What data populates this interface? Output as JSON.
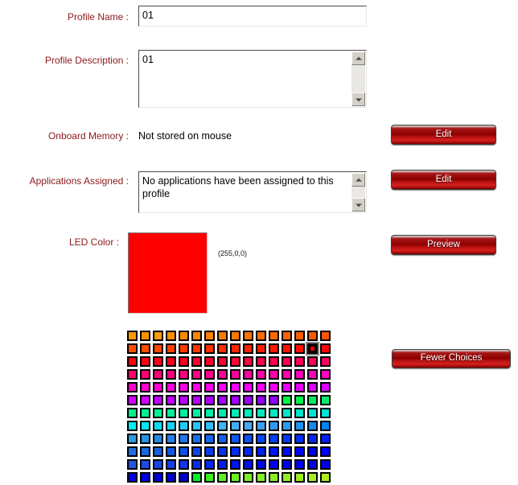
{
  "form": {
    "profile_name": {
      "label": "Profile Name :",
      "value": "01"
    },
    "profile_description": {
      "label": "Profile Description :",
      "value": "01"
    },
    "onboard_memory": {
      "label": "Onboard Memory :",
      "value": "Not stored on mouse",
      "button": "Edit"
    },
    "applications_assigned": {
      "label": "Applications Assigned :",
      "value": "No applications have been assigned to this profile",
      "button": "Edit"
    },
    "led_color": {
      "label": "LED Color :",
      "swatch_hex": "#FF0000",
      "rgb_text": "(255,0,0)",
      "button": "Preview"
    },
    "palette": {
      "fewer_choices_button": "Fewer Choices",
      "columns": 16,
      "rows": 12,
      "selected_index": 30,
      "colors": [
        "#FF9900",
        "#FF8F00",
        "#FF9A0A",
        "#FF8C00",
        "#FF8A00",
        "#FF8500",
        "#FF8000",
        "#FF7B00",
        "#FF7600",
        "#FF7200",
        "#FF6D00",
        "#FF6800",
        "#FF6300",
        "#FF5E00",
        "#FF5900",
        "#FF5400",
        "#FF4F00",
        "#FF4A00",
        "#FF4500",
        "#FF4000",
        "#FF3B00",
        "#FF3600",
        "#FF3100",
        "#FF2C00",
        "#FF2700",
        "#FF2200",
        "#FF1D00",
        "#FF1800",
        "#FF1300",
        "#FF0E00",
        "#FF0000",
        "#FF0505",
        "#FF000A",
        "#FF0010",
        "#FF0016",
        "#FF001C",
        "#FF0022",
        "#FF0028",
        "#FF002E",
        "#FF0034",
        "#FF003A",
        "#FF0040",
        "#FF0046",
        "#FF004C",
        "#FF0052",
        "#FF0058",
        "#FF005E",
        "#FF0064",
        "#FF006A",
        "#FF0070",
        "#FF0076",
        "#FF007C",
        "#FF0082",
        "#FF0088",
        "#FF008E",
        "#FF0094",
        "#FF009A",
        "#FF00A0",
        "#FF00A6",
        "#FF00AC",
        "#FF00B2",
        "#FF00B8",
        "#FF00BE",
        "#FF00C4",
        "#FF00CA",
        "#FF00D0",
        "#FF00D6",
        "#FF00DC",
        "#FF00E2",
        "#FF00E8",
        "#FF00EE",
        "#FF00F4",
        "#FF00FA",
        "#FD00FF",
        "#F700FF",
        "#F100FF",
        "#EB00FF",
        "#E500FF",
        "#DF00FF",
        "#D900FF",
        "#D300FF",
        "#CD00FF",
        "#C700FF",
        "#C100FF",
        "#BB00FF",
        "#B500FF",
        "#AF00FF",
        "#A900FF",
        "#A300FF",
        "#9D00FF",
        "#9700FF",
        "#9100FF",
        "#00F542",
        "#00F24F",
        "#00EF5C",
        "#00EC69",
        "#00F08C",
        "#00F091",
        "#00F096",
        "#00EF9B",
        "#00EEA0",
        "#00EDA5",
        "#00ECAA",
        "#00EBAF",
        "#00EAB4",
        "#00E9B9",
        "#00E8BE",
        "#00E7C3",
        "#00E6C8",
        "#00E5CD",
        "#00E4D2",
        "#00E3D7",
        "#00F0F0",
        "#00E8F5",
        "#0ADCF8",
        "#14D4FA",
        "#1ECCFA",
        "#28C4FA",
        "#32BCFA",
        "#3CB4F8",
        "#46ACF6",
        "#46A8F4",
        "#3CA0F2",
        "#3298F0",
        "#289CF5",
        "#1E94F2",
        "#1489F0",
        "#0A80EE",
        "#2D9BE0",
        "#2A93E2",
        "#2688E4",
        "#2280E6",
        "#1E78E8",
        "#1A70EA",
        "#1668EC",
        "#1260EE",
        "#0E58F0",
        "#0A50F2",
        "#0648F4",
        "#0240F6",
        "#0038F8",
        "#0030FA",
        "#0028FC",
        "#0020FE",
        "#1E6EE0",
        "#1A66E2",
        "#165EE4",
        "#1256E6",
        "#0E4EE8",
        "#0A46EA",
        "#063EEC",
        "#0236EE",
        "#002EF0",
        "#0026F2",
        "#001EF4",
        "#0016F6",
        "#000EF8",
        "#0006FA",
        "#0000FC",
        "#0000FE",
        "#2055E0",
        "#1C4DE2",
        "#1845E4",
        "#143DE6",
        "#1035E8",
        "#0C2DEA",
        "#0825EC",
        "#041DED",
        "#0015EE",
        "#000DEF",
        "#0005F0",
        "#0000F1",
        "#0000F0",
        "#0000EE",
        "#0000EC",
        "#0000EA",
        "#0000E8",
        "#0000E0",
        "#0000D8",
        "#0000D0",
        "#0000C8",
        "#00F025",
        "#3CEE20",
        "#5CEE22",
        "#6CEE22",
        "#7CEE22",
        "#84EE22",
        "#8CEE22",
        "#94EE22",
        "#9CEE22",
        "#A4EE22",
        "#ACEE22"
      ]
    }
  }
}
